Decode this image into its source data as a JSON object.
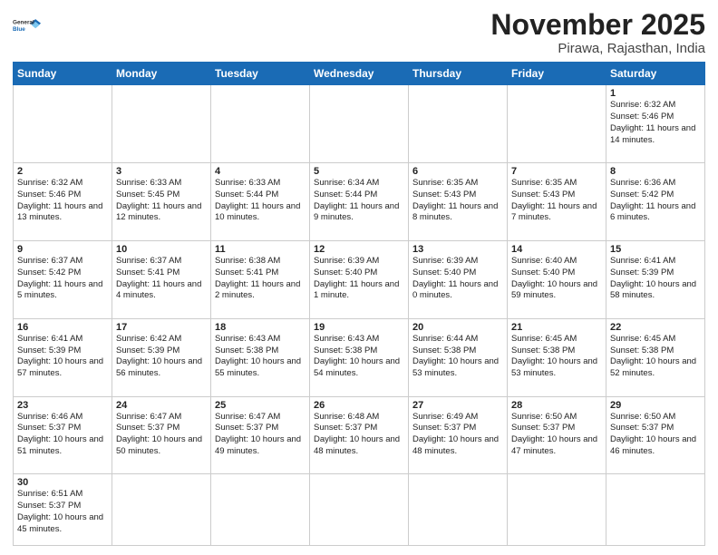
{
  "header": {
    "logo_general": "General",
    "logo_blue": "Blue",
    "month_title": "November 2025",
    "location": "Pirawa, Rajasthan, India"
  },
  "weekdays": [
    "Sunday",
    "Monday",
    "Tuesday",
    "Wednesday",
    "Thursday",
    "Friday",
    "Saturday"
  ],
  "weeks": [
    [
      {
        "day": "",
        "empty": true
      },
      {
        "day": "",
        "empty": true
      },
      {
        "day": "",
        "empty": true
      },
      {
        "day": "",
        "empty": true
      },
      {
        "day": "",
        "empty": true
      },
      {
        "day": "",
        "empty": true
      },
      {
        "day": "1",
        "sunrise": "6:32 AM",
        "sunset": "5:46 PM",
        "daylight": "11 hours and 14 minutes."
      }
    ],
    [
      {
        "day": "2",
        "sunrise": "6:32 AM",
        "sunset": "5:46 PM",
        "daylight": "11 hours and 13 minutes."
      },
      {
        "day": "3",
        "sunrise": "6:33 AM",
        "sunset": "5:45 PM",
        "daylight": "11 hours and 12 minutes."
      },
      {
        "day": "4",
        "sunrise": "6:33 AM",
        "sunset": "5:44 PM",
        "daylight": "11 hours and 10 minutes."
      },
      {
        "day": "5",
        "sunrise": "6:34 AM",
        "sunset": "5:44 PM",
        "daylight": "11 hours and 9 minutes."
      },
      {
        "day": "6",
        "sunrise": "6:35 AM",
        "sunset": "5:43 PM",
        "daylight": "11 hours and 8 minutes."
      },
      {
        "day": "7",
        "sunrise": "6:35 AM",
        "sunset": "5:43 PM",
        "daylight": "11 hours and 7 minutes."
      },
      {
        "day": "8",
        "sunrise": "6:36 AM",
        "sunset": "5:42 PM",
        "daylight": "11 hours and 6 minutes."
      }
    ],
    [
      {
        "day": "9",
        "sunrise": "6:37 AM",
        "sunset": "5:42 PM",
        "daylight": "11 hours and 5 minutes."
      },
      {
        "day": "10",
        "sunrise": "6:37 AM",
        "sunset": "5:41 PM",
        "daylight": "11 hours and 4 minutes."
      },
      {
        "day": "11",
        "sunrise": "6:38 AM",
        "sunset": "5:41 PM",
        "daylight": "11 hours and 2 minutes."
      },
      {
        "day": "12",
        "sunrise": "6:39 AM",
        "sunset": "5:40 PM",
        "daylight": "11 hours and 1 minute."
      },
      {
        "day": "13",
        "sunrise": "6:39 AM",
        "sunset": "5:40 PM",
        "daylight": "11 hours and 0 minutes."
      },
      {
        "day": "14",
        "sunrise": "6:40 AM",
        "sunset": "5:40 PM",
        "daylight": "10 hours and 59 minutes."
      },
      {
        "day": "15",
        "sunrise": "6:41 AM",
        "sunset": "5:39 PM",
        "daylight": "10 hours and 58 minutes."
      }
    ],
    [
      {
        "day": "16",
        "sunrise": "6:41 AM",
        "sunset": "5:39 PM",
        "daylight": "10 hours and 57 minutes."
      },
      {
        "day": "17",
        "sunrise": "6:42 AM",
        "sunset": "5:39 PM",
        "daylight": "10 hours and 56 minutes."
      },
      {
        "day": "18",
        "sunrise": "6:43 AM",
        "sunset": "5:38 PM",
        "daylight": "10 hours and 55 minutes."
      },
      {
        "day": "19",
        "sunrise": "6:43 AM",
        "sunset": "5:38 PM",
        "daylight": "10 hours and 54 minutes."
      },
      {
        "day": "20",
        "sunrise": "6:44 AM",
        "sunset": "5:38 PM",
        "daylight": "10 hours and 53 minutes."
      },
      {
        "day": "21",
        "sunrise": "6:45 AM",
        "sunset": "5:38 PM",
        "daylight": "10 hours and 53 minutes."
      },
      {
        "day": "22",
        "sunrise": "6:45 AM",
        "sunset": "5:38 PM",
        "daylight": "10 hours and 52 minutes."
      }
    ],
    [
      {
        "day": "23",
        "sunrise": "6:46 AM",
        "sunset": "5:37 PM",
        "daylight": "10 hours and 51 minutes."
      },
      {
        "day": "24",
        "sunrise": "6:47 AM",
        "sunset": "5:37 PM",
        "daylight": "10 hours and 50 minutes."
      },
      {
        "day": "25",
        "sunrise": "6:47 AM",
        "sunset": "5:37 PM",
        "daylight": "10 hours and 49 minutes."
      },
      {
        "day": "26",
        "sunrise": "6:48 AM",
        "sunset": "5:37 PM",
        "daylight": "10 hours and 48 minutes."
      },
      {
        "day": "27",
        "sunrise": "6:49 AM",
        "sunset": "5:37 PM",
        "daylight": "10 hours and 48 minutes."
      },
      {
        "day": "28",
        "sunrise": "6:50 AM",
        "sunset": "5:37 PM",
        "daylight": "10 hours and 47 minutes."
      },
      {
        "day": "29",
        "sunrise": "6:50 AM",
        "sunset": "5:37 PM",
        "daylight": "10 hours and 46 minutes."
      }
    ],
    [
      {
        "day": "30",
        "sunrise": "6:51 AM",
        "sunset": "5:37 PM",
        "daylight": "10 hours and 45 minutes."
      },
      {
        "day": "",
        "empty": true
      },
      {
        "day": "",
        "empty": true
      },
      {
        "day": "",
        "empty": true
      },
      {
        "day": "",
        "empty": true
      },
      {
        "day": "",
        "empty": true
      },
      {
        "day": "",
        "empty": true
      }
    ]
  ],
  "labels": {
    "sunrise": "Sunrise:",
    "sunset": "Sunset:",
    "daylight": "Daylight:"
  }
}
